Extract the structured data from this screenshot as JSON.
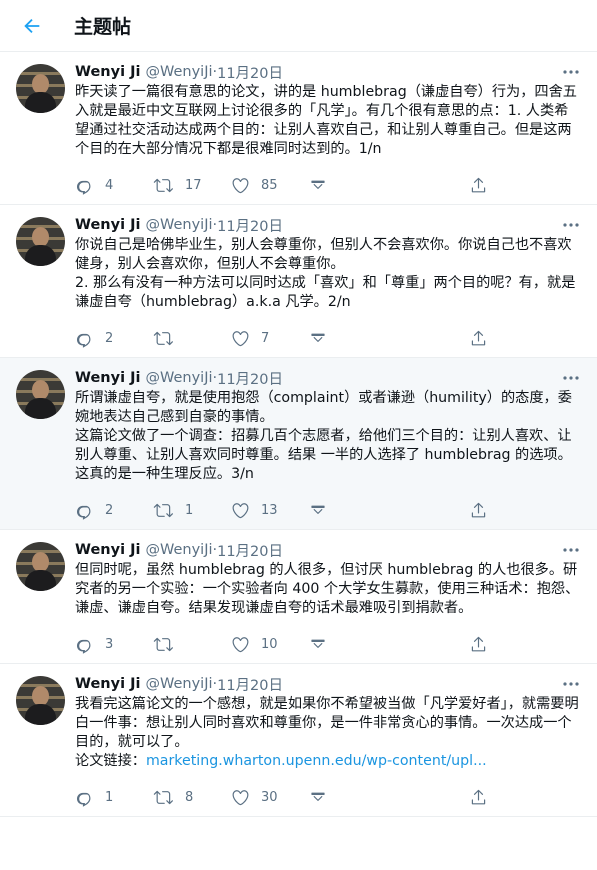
{
  "header": {
    "title": "主题帖"
  },
  "tweets": [
    {
      "name": "Wenyi Ji",
      "handle": "@WenyiJi",
      "sep": " · ",
      "date": "11月20日",
      "text": "昨天读了一篇很有意思的论文，讲的是 humblebrag（谦虚自夸）行为，四舍五入就是最近中文互联网上讨论很多的「凡学」。有几个很有意思的点：1. 人类希望通过社交活动达成两个目的：让别人喜欢自己，和让别人尊重自己。但是这两个目的在大部分情况下都是很难同时达到的。1/n",
      "replies": "4",
      "retweets": "17",
      "likes": "85"
    },
    {
      "name": "Wenyi Ji",
      "handle": "@WenyiJi",
      "sep": " · ",
      "date": "11月20日",
      "text": "你说自己是哈佛毕业生，别人会尊重你，但别人不会喜欢你。你说自己也不喜欢健身，别人会喜欢你，但别人不会尊重你。\n2. 那么有没有一种方法可以同时达成「喜欢」和「尊重」两个目的呢？有，就是谦虚自夸（humblebrag）a.k.a 凡学。2/n",
      "replies": "2",
      "retweets": "",
      "likes": "7"
    },
    {
      "name": "Wenyi Ji",
      "handle": "@WenyiJi",
      "sep": " · ",
      "date": "11月20日",
      "text": "所谓谦虚自夸，就是使用抱怨（complaint）或者谦逊（humility）的态度，委婉地表达自己感到自豪的事情。\n这篇论文做了一个调查：招募几百个志愿者，给他们三个目的：让别人喜欢、让别人尊重、让别人喜欢同时尊重。结果 一半的人选择了 humblebrag 的选项。\n这真的是一种生理反应。3/n",
      "replies": "2",
      "retweets": "1",
      "likes": "13"
    },
    {
      "name": "Wenyi Ji",
      "handle": "@WenyiJi",
      "sep": " · ",
      "date": "11月20日",
      "text": "但同时呢，虽然 humblebrag 的人很多，但讨厌 humblebrag 的人也很多。研究者的另一个实验：一个实验者向 400 个大学女生募款，使用三种话术：抱怨、谦虚、谦虚自夸。结果发现谦虚自夸的话术最难吸引到捐款者。",
      "replies": "3",
      "retweets": "",
      "likes": "10"
    },
    {
      "name": "Wenyi Ji",
      "handle": "@WenyiJi",
      "sep": " · ",
      "date": "11月20日",
      "text": "我看完这篇论文的一个感想，就是如果你不希望被当做「凡学爱好者」，就需要明白一件事：想让别人同时喜欢和尊重你，是一件非常贪心的事情。一次达成一个目的，就可以了。\n论文链接：",
      "link": "marketing.wharton.upenn.edu/wp-content/upl...",
      "replies": "1",
      "retweets": "8",
      "likes": "30"
    }
  ],
  "colors": {
    "accent": "#1da1f2",
    "muted": "#5b7083",
    "link": "#1b95e0"
  },
  "icons": [
    "back-arrow-icon",
    "more-icon",
    "reply-icon",
    "retweet-icon",
    "like-icon",
    "caret-down-icon",
    "share-icon"
  ]
}
